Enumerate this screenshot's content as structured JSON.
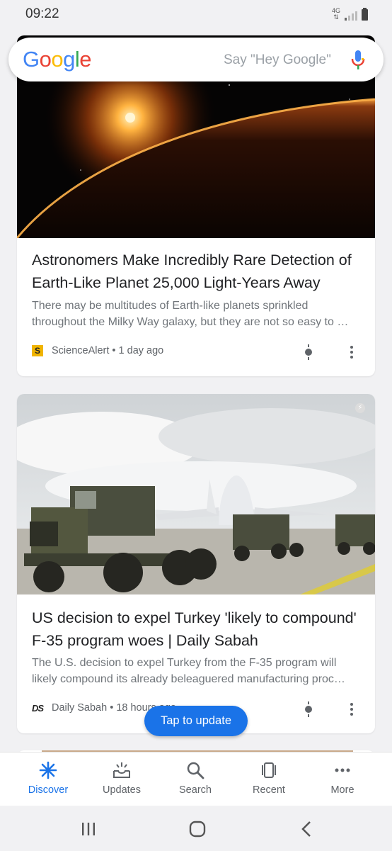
{
  "status_bar": {
    "time": "09:22",
    "network": "4G"
  },
  "search": {
    "logo": "Google",
    "placeholder": "Say \"Hey Google\""
  },
  "feed": {
    "cards": [
      {
        "title": "Astronomers Make Incredibly Rare Detection of Earth-Like Planet 25,000 Light-Years Away",
        "snippet": "There may be multitudes of Earth-like planets sprinkled throughout the Milky Way galaxy, but they are not so easy to …",
        "source": "ScienceAlert",
        "source_logo": "S",
        "time": "1 day ago",
        "separator": " • "
      },
      {
        "title": "US decision to expel Turkey 'likely to compound' F-35 program woes | Daily Sabah",
        "snippet": "The U.S. decision to expel Turkey from the F-35 program will likely compound its already beleaguered manufacturing proc…",
        "source": "Daily Sabah",
        "source_logo": "DS",
        "time": "18 hours ago",
        "separator": " • "
      }
    ]
  },
  "tap_to_update": "Tap to update",
  "bottom_nav": {
    "items": [
      {
        "label": "Discover",
        "icon": "discover-icon",
        "active": true
      },
      {
        "label": "Updates",
        "icon": "updates-icon",
        "active": false
      },
      {
        "label": "Search",
        "icon": "search-icon",
        "active": false
      },
      {
        "label": "Recent",
        "icon": "recent-icon",
        "active": false
      },
      {
        "label": "More",
        "icon": "more-horiz-icon",
        "active": false
      }
    ]
  },
  "colors": {
    "accent": "#1a73e8",
    "background": "#f1f1f3",
    "sciencealert_yellow": "#f0b400"
  }
}
